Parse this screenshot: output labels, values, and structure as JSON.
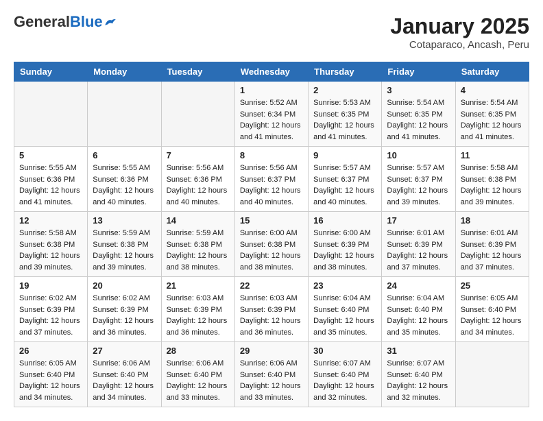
{
  "header": {
    "logo_general": "General",
    "logo_blue": "Blue",
    "month_year": "January 2025",
    "location": "Cotaparaco, Ancash, Peru"
  },
  "weekdays": [
    "Sunday",
    "Monday",
    "Tuesday",
    "Wednesday",
    "Thursday",
    "Friday",
    "Saturday"
  ],
  "weeks": [
    [
      {
        "day": "",
        "info": ""
      },
      {
        "day": "",
        "info": ""
      },
      {
        "day": "",
        "info": ""
      },
      {
        "day": "1",
        "info": "Sunrise: 5:52 AM\nSunset: 6:34 PM\nDaylight: 12 hours and 41 minutes."
      },
      {
        "day": "2",
        "info": "Sunrise: 5:53 AM\nSunset: 6:35 PM\nDaylight: 12 hours and 41 minutes."
      },
      {
        "day": "3",
        "info": "Sunrise: 5:54 AM\nSunset: 6:35 PM\nDaylight: 12 hours and 41 minutes."
      },
      {
        "day": "4",
        "info": "Sunrise: 5:54 AM\nSunset: 6:35 PM\nDaylight: 12 hours and 41 minutes."
      }
    ],
    [
      {
        "day": "5",
        "info": "Sunrise: 5:55 AM\nSunset: 6:36 PM\nDaylight: 12 hours and 41 minutes."
      },
      {
        "day": "6",
        "info": "Sunrise: 5:55 AM\nSunset: 6:36 PM\nDaylight: 12 hours and 40 minutes."
      },
      {
        "day": "7",
        "info": "Sunrise: 5:56 AM\nSunset: 6:36 PM\nDaylight: 12 hours and 40 minutes."
      },
      {
        "day": "8",
        "info": "Sunrise: 5:56 AM\nSunset: 6:37 PM\nDaylight: 12 hours and 40 minutes."
      },
      {
        "day": "9",
        "info": "Sunrise: 5:57 AM\nSunset: 6:37 PM\nDaylight: 12 hours and 40 minutes."
      },
      {
        "day": "10",
        "info": "Sunrise: 5:57 AM\nSunset: 6:37 PM\nDaylight: 12 hours and 39 minutes."
      },
      {
        "day": "11",
        "info": "Sunrise: 5:58 AM\nSunset: 6:38 PM\nDaylight: 12 hours and 39 minutes."
      }
    ],
    [
      {
        "day": "12",
        "info": "Sunrise: 5:58 AM\nSunset: 6:38 PM\nDaylight: 12 hours and 39 minutes."
      },
      {
        "day": "13",
        "info": "Sunrise: 5:59 AM\nSunset: 6:38 PM\nDaylight: 12 hours and 39 minutes."
      },
      {
        "day": "14",
        "info": "Sunrise: 5:59 AM\nSunset: 6:38 PM\nDaylight: 12 hours and 38 minutes."
      },
      {
        "day": "15",
        "info": "Sunrise: 6:00 AM\nSunset: 6:38 PM\nDaylight: 12 hours and 38 minutes."
      },
      {
        "day": "16",
        "info": "Sunrise: 6:00 AM\nSunset: 6:39 PM\nDaylight: 12 hours and 38 minutes."
      },
      {
        "day": "17",
        "info": "Sunrise: 6:01 AM\nSunset: 6:39 PM\nDaylight: 12 hours and 37 minutes."
      },
      {
        "day": "18",
        "info": "Sunrise: 6:01 AM\nSunset: 6:39 PM\nDaylight: 12 hours and 37 minutes."
      }
    ],
    [
      {
        "day": "19",
        "info": "Sunrise: 6:02 AM\nSunset: 6:39 PM\nDaylight: 12 hours and 37 minutes."
      },
      {
        "day": "20",
        "info": "Sunrise: 6:02 AM\nSunset: 6:39 PM\nDaylight: 12 hours and 36 minutes."
      },
      {
        "day": "21",
        "info": "Sunrise: 6:03 AM\nSunset: 6:39 PM\nDaylight: 12 hours and 36 minutes."
      },
      {
        "day": "22",
        "info": "Sunrise: 6:03 AM\nSunset: 6:39 PM\nDaylight: 12 hours and 36 minutes."
      },
      {
        "day": "23",
        "info": "Sunrise: 6:04 AM\nSunset: 6:40 PM\nDaylight: 12 hours and 35 minutes."
      },
      {
        "day": "24",
        "info": "Sunrise: 6:04 AM\nSunset: 6:40 PM\nDaylight: 12 hours and 35 minutes."
      },
      {
        "day": "25",
        "info": "Sunrise: 6:05 AM\nSunset: 6:40 PM\nDaylight: 12 hours and 34 minutes."
      }
    ],
    [
      {
        "day": "26",
        "info": "Sunrise: 6:05 AM\nSunset: 6:40 PM\nDaylight: 12 hours and 34 minutes."
      },
      {
        "day": "27",
        "info": "Sunrise: 6:06 AM\nSunset: 6:40 PM\nDaylight: 12 hours and 34 minutes."
      },
      {
        "day": "28",
        "info": "Sunrise: 6:06 AM\nSunset: 6:40 PM\nDaylight: 12 hours and 33 minutes."
      },
      {
        "day": "29",
        "info": "Sunrise: 6:06 AM\nSunset: 6:40 PM\nDaylight: 12 hours and 33 minutes."
      },
      {
        "day": "30",
        "info": "Sunrise: 6:07 AM\nSunset: 6:40 PM\nDaylight: 12 hours and 32 minutes."
      },
      {
        "day": "31",
        "info": "Sunrise: 6:07 AM\nSunset: 6:40 PM\nDaylight: 12 hours and 32 minutes."
      },
      {
        "day": "",
        "info": ""
      }
    ]
  ]
}
